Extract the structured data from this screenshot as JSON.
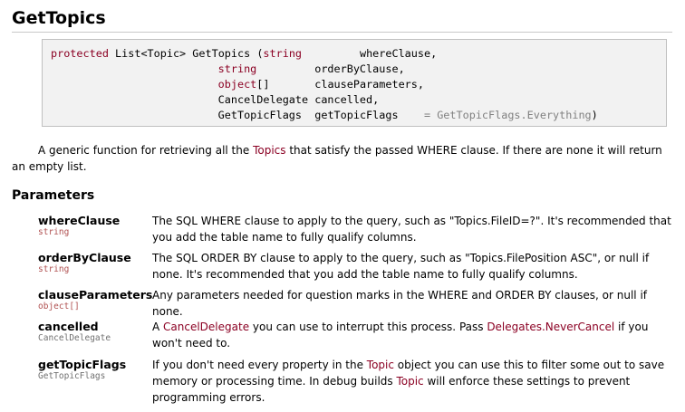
{
  "title": "GetTopics",
  "signature": {
    "prefix_kw": "protected",
    "return_type": "List<Topic>",
    "method": "GetTopics",
    "open_paren": "(",
    "params": [
      {
        "type": "string",
        "name": "whereClause",
        "suffix": ","
      },
      {
        "type": "string",
        "name": "orderByClause",
        "suffix": ","
      },
      {
        "type": "object",
        "type_suffix": "[]",
        "name": "clauseParameters",
        "suffix": ","
      },
      {
        "type": "CancelDelegate",
        "name": "cancelled",
        "suffix": ","
      },
      {
        "type": "GetTopicFlags",
        "name": "getTopicFlags",
        "default": "= GetTopicFlags.Everything",
        "suffix": ")"
      }
    ]
  },
  "description": {
    "before": "A generic function for retrieving all the ",
    "link": "Topics",
    "after": " that satisfy the passed WHERE clause.  If there are none it will return an empty list."
  },
  "parameters_heading": "Parameters",
  "parameters": [
    {
      "name": "whereClause",
      "type": "string",
      "description": "The SQL WHERE clause to apply to the query, such as \"Topics.FileID=?\".  It's recommended that you add the table name to fully qualify columns."
    },
    {
      "name": "orderByClause",
      "type": "string",
      "description": "The SQL ORDER BY clause to apply to the query, such as \"Topics.FilePosition ASC\", or null if none.  It's recommended that you add the table name to fully qualify columns."
    },
    {
      "name": "clauseParameters",
      "type": "object[]",
      "description": "Any parameters needed for question marks in the WHERE and ORDER BY clauses, or null if none."
    },
    {
      "name": "cancelled",
      "type": "CancelDelegate",
      "description_parts": [
        "A ",
        "CancelDelegate",
        " you can use to interrupt this process.  Pass ",
        "Delegates.NeverCancel",
        " if you won't need to."
      ]
    },
    {
      "name": "getTopicFlags",
      "type": "GetTopicFlags",
      "description_parts": [
        "If you don't need every property in the ",
        "Topic",
        " object you can use this to filter some out to save memory or processing time.  In debug builds ",
        "Topic",
        " will enforce these settings to prevent programming errors."
      ]
    }
  ],
  "colors": {
    "keyword": "#8b0023",
    "link": "#8b0023",
    "code_background": "#f2f2f2",
    "code_border": "#c0c0c0",
    "default_value": "#808080"
  }
}
